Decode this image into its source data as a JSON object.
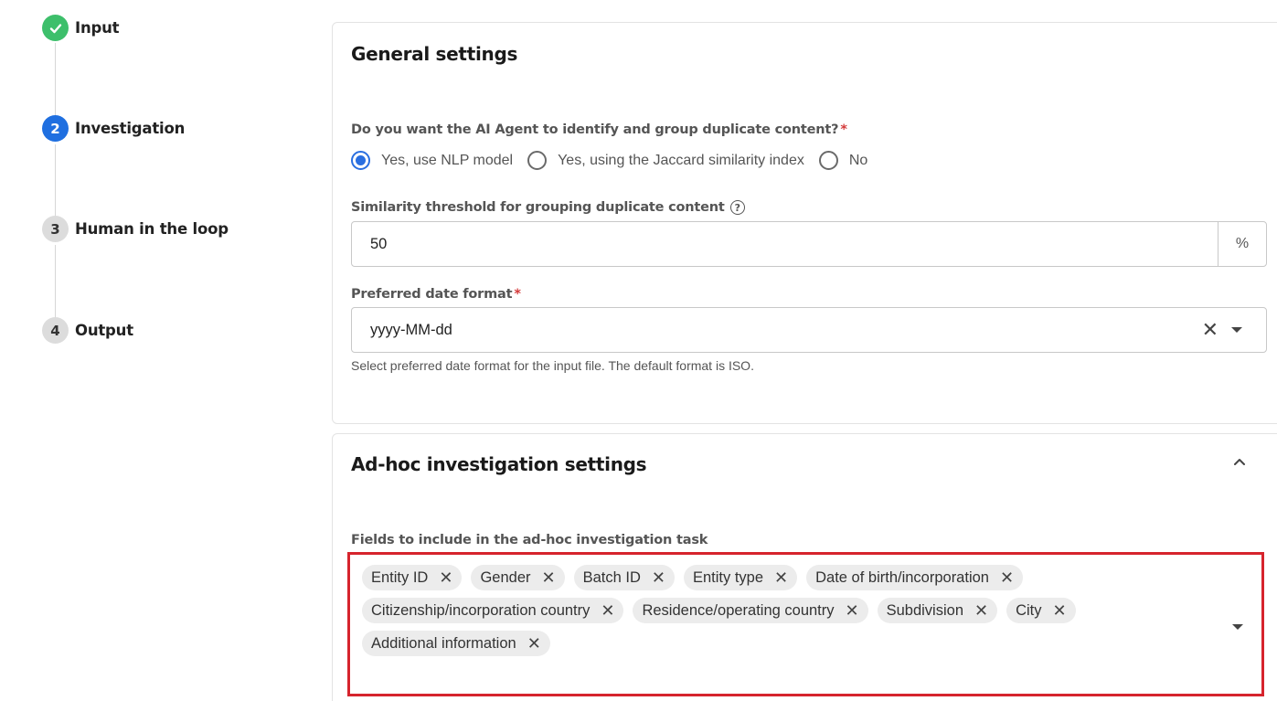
{
  "stepper": {
    "steps": [
      {
        "number": "",
        "label": "Input",
        "state": "done"
      },
      {
        "number": "2",
        "label": "Investigation",
        "state": "active"
      },
      {
        "number": "3",
        "label": "Human in the loop",
        "state": "todo"
      },
      {
        "number": "4",
        "label": "Output",
        "state": "todo"
      }
    ]
  },
  "general": {
    "title": "General settings",
    "duplicate_question": "Do you want the AI Agent to identify and group duplicate content?",
    "required_mark": "*",
    "radio_options": [
      {
        "label": "Yes, use NLP model",
        "checked": true
      },
      {
        "label": "Yes, using the Jaccard similarity index",
        "checked": false
      },
      {
        "label": "No",
        "checked": false
      }
    ],
    "threshold_label": "Similarity threshold for grouping duplicate content",
    "threshold_value": "50",
    "threshold_suffix": "%",
    "date_label": "Preferred date format",
    "date_value": "yyyy-MM-dd",
    "date_hint": "Select preferred date format for the input file. The default format is ISO."
  },
  "adhoc": {
    "title": "Ad-hoc investigation settings",
    "fields_label": "Fields to include in the ad-hoc investigation task",
    "chips": [
      [
        "Entity ID",
        "Gender",
        "Batch ID",
        "Entity type",
        "Date of birth/incorporation"
      ],
      [
        "Citizenship/incorporation country",
        "Residence/operating country",
        "Subdivision",
        "City"
      ],
      [
        "Additional information"
      ]
    ]
  },
  "icons": {
    "check": "check-icon",
    "help": "help-circle-icon",
    "clear": "close-icon",
    "dropdown": "chevron-down-icon",
    "collapse": "chevron-up-icon"
  },
  "colors": {
    "success": "#3dbf6b",
    "primary": "#1f6fe0",
    "highlight_border": "#d6242d",
    "required": "#d43a3a"
  }
}
